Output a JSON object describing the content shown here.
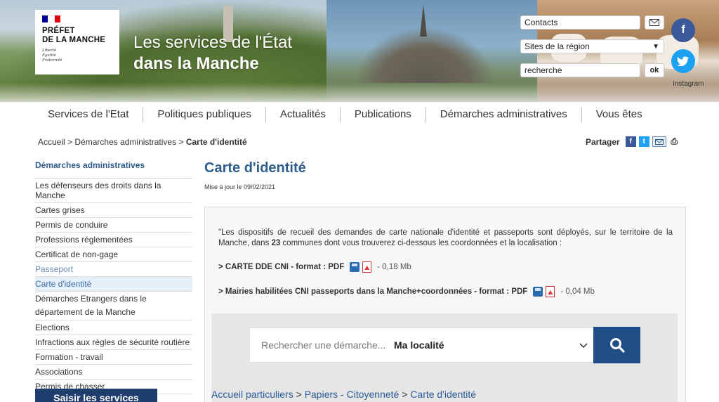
{
  "header": {
    "logo": {
      "title_line1": "PRÉFET",
      "title_line2": "DE LA MANCHE",
      "motto": [
        "Liberté",
        "Égalité",
        "Fraternité"
      ],
      "flag_colors": [
        "#000091",
        "#ffffff",
        "#e1000f"
      ]
    },
    "site_title_line1": "Les services de l'État",
    "site_title_line2": "dans la Manche",
    "contacts_label": "Contacts",
    "region_select_value": "Sites de la région",
    "search_value": "recherche",
    "search_ok": "ok",
    "mail_icon": "envelope-icon",
    "social": {
      "facebook_icon": "facebook-icon",
      "twitter_icon": "twitter-icon",
      "facebook_color": "#3b5998",
      "twitter_color": "#1da1f2",
      "instagram_label": "Instagram"
    }
  },
  "nav": {
    "items": [
      "Services de l'Etat",
      "Politiques publiques",
      "Actualités",
      "Publications",
      "Démarches administratives",
      "Vous êtes"
    ]
  },
  "breadcrumb": {
    "home": "Accueil",
    "sep": ">",
    "section": "Démarches administratives",
    "current": "Carte d'identité"
  },
  "share": {
    "label": "Partager",
    "icons": [
      "facebook-icon",
      "twitter-icon",
      "envelope-icon",
      "print-icon"
    ]
  },
  "sidebar": {
    "title": "Démarches administratives",
    "items": [
      "Les défenseurs des droits dans la Manche",
      "Cartes grises",
      "Permis de conduire",
      "Professions réglementées",
      "Certificat de non-gage",
      "Passeport",
      "Carte d'identité",
      "Démarches Etrangers dans le département de la Manche",
      "Elections",
      "Infractions aux règles de sécurité routière",
      "Formation - travail",
      "Associations",
      "Permis de chasser"
    ],
    "cta": "Saisir les services"
  },
  "main": {
    "title": "Carte d'identité",
    "update": "Mise à jour le 09/02/2021",
    "intro_before": "\"Les dispositifs de recueil des demandes de carte nationale d'identité et passeports sont déployés, sur le territoire de la Manche, dans ",
    "intro_bold": "23",
    "intro_after": " communes dont vous trouverez ci-dessous les coordonnées et la localisation :",
    "downloads": [
      {
        "label": "> CARTE DDE CNI - format : PDF",
        "size": "- 0,18 Mb"
      },
      {
        "label": "> Mairies habilitées CNI passeports dans la Manche+coordonnées - format : PDF",
        "size": "- 0,04 Mb"
      }
    ],
    "search": {
      "placeholder": "Rechercher une démarche...",
      "location": "Ma localité",
      "button_icon": "search-icon"
    },
    "bottom_breadcrumb": [
      "Accueil particuliers",
      "Papiers - Citoyenneté",
      "Carte d'identité"
    ]
  }
}
